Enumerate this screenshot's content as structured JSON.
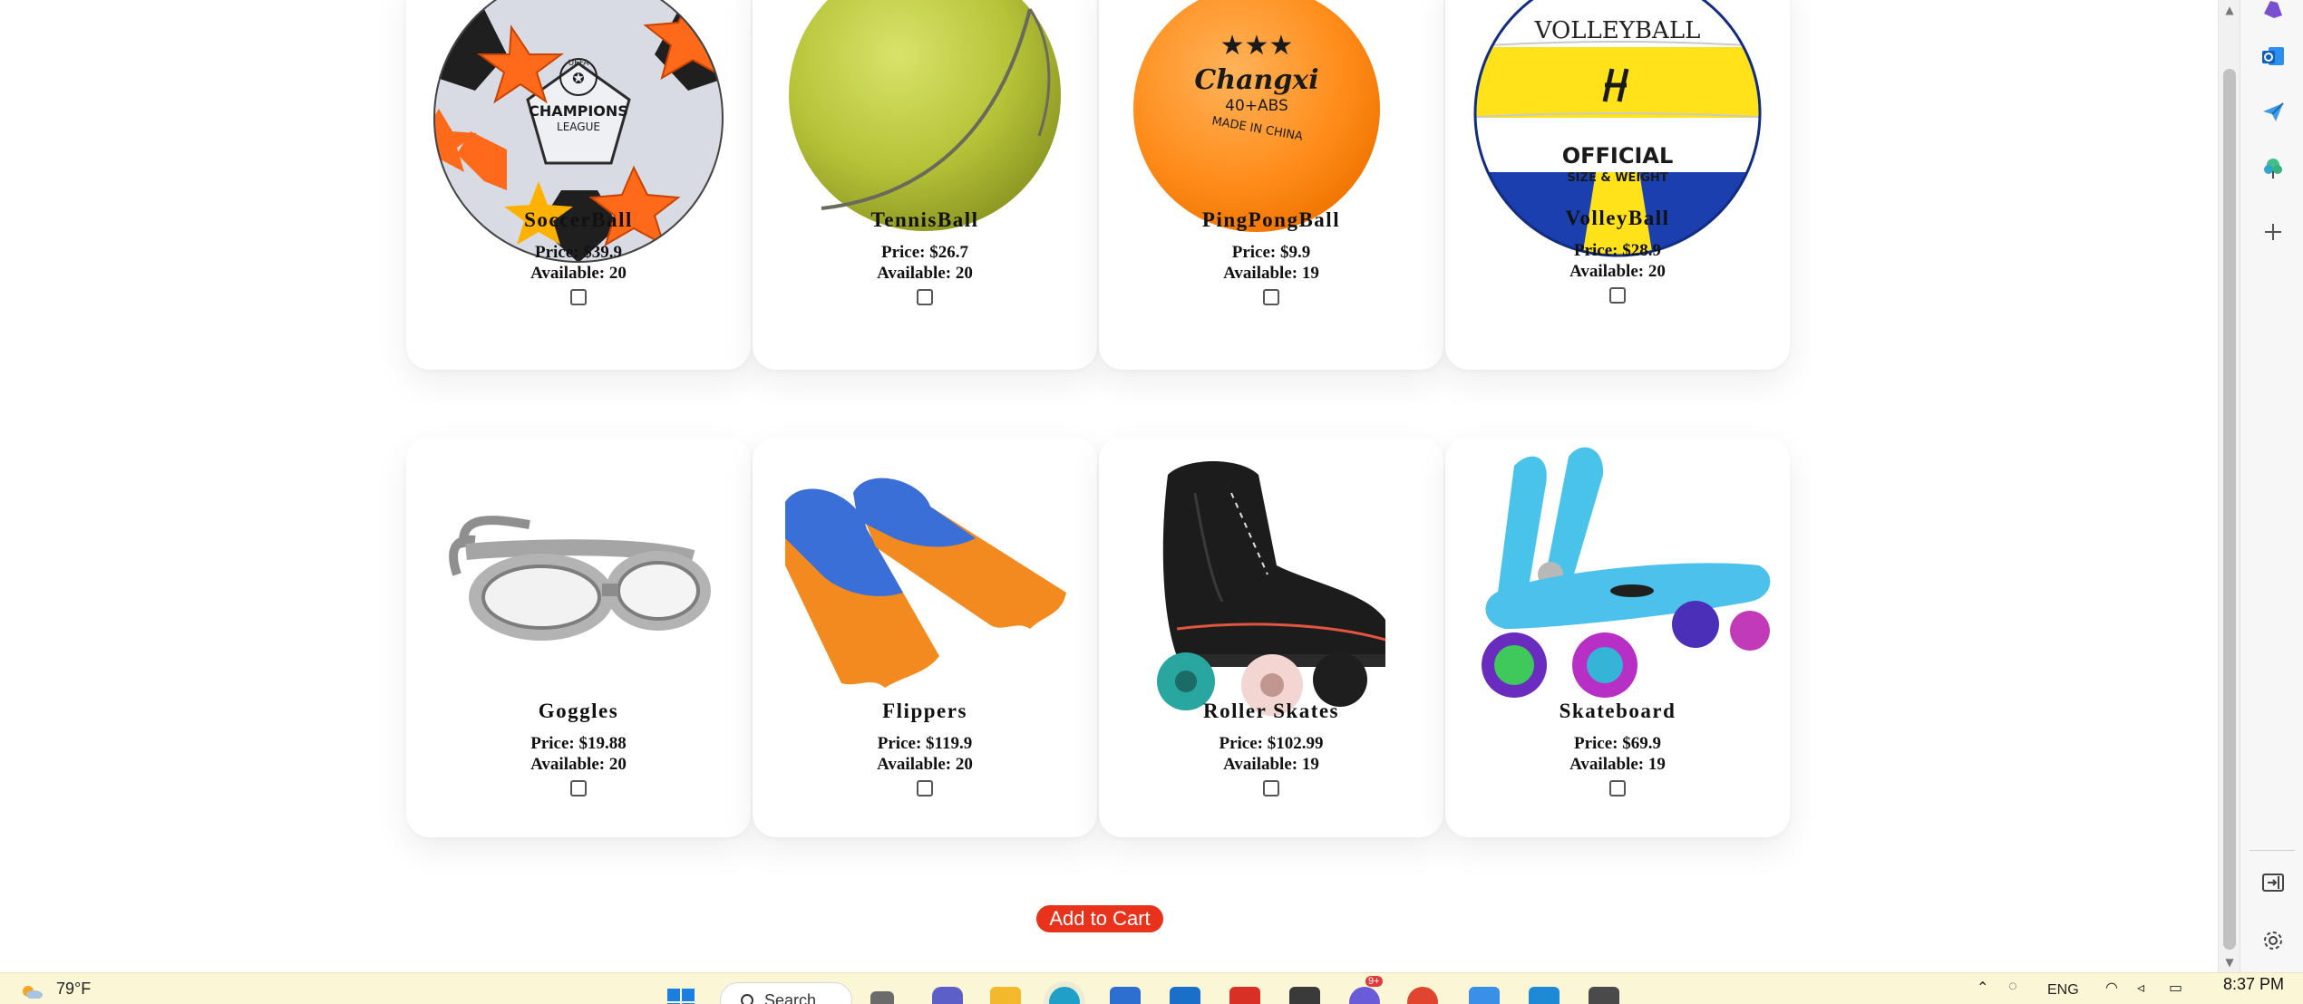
{
  "products": [
    {
      "name": "SoccerBall",
      "price": "Price: $39.9",
      "available": "Available: 20",
      "image": "soccer-ball"
    },
    {
      "name": "TennisBall",
      "price": "Price: $26.7",
      "available": "Available: 20",
      "image": "tennis-ball"
    },
    {
      "name": "PingPongBall",
      "price": "Price: $9.9",
      "available": "Available: 19",
      "image": "ping-pong-ball"
    },
    {
      "name": "VolleyBall",
      "price": "Price: $28.9",
      "available": "Available: 20",
      "image": "volleyball"
    },
    {
      "name": "Goggles",
      "price": "Price: $19.88",
      "available": "Available: 20",
      "image": "swim-goggles"
    },
    {
      "name": "Flippers",
      "price": "Price: $119.9",
      "available": "Available: 20",
      "image": "swim-flippers"
    },
    {
      "name": "Roller Skates",
      "price": "Price: $102.99",
      "available": "Available: 19",
      "image": "roller-skate"
    },
    {
      "name": "Skateboard",
      "price": "Price: $69.9",
      "available": "Available: 19",
      "image": "skateboard"
    }
  ],
  "cart_button": "Add to Cart",
  "image_text": {
    "soccer_line1": "UEFA",
    "soccer_line2": "CHAMPIONS",
    "soccer_line3": "LEAGUE",
    "pingpong_stars": "★★★",
    "pingpong_brand": "Changxi",
    "pingpong_spec": "40+ABS",
    "pingpong_origin": "MADE IN CHINA",
    "volley_brand": "VOLLEYBALL",
    "volley_official": "OFFICIAL",
    "volley_size": "SIZE & WEIGHT"
  },
  "sidebar_icons": [
    "copilot-icon",
    "outlook-icon",
    "send-icon",
    "tree-icon",
    "add-icon",
    "panel-icon",
    "settings-icon"
  ],
  "taskbar": {
    "temperature": "79°F",
    "search_label": "Search",
    "language": "ENG",
    "time": "8:37 PM",
    "notification_badge": "9+"
  },
  "colors": {
    "button": "#e8321c",
    "taskbar": "#fbf7d6"
  }
}
